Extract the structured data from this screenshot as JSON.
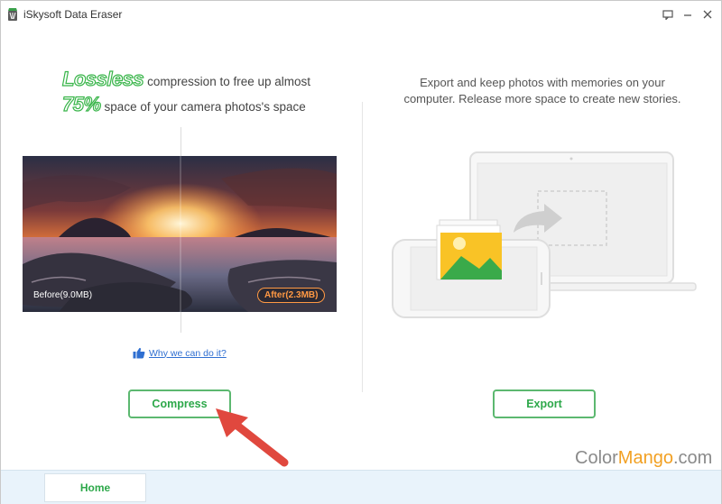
{
  "window": {
    "title": "iSkysoft Data Eraser"
  },
  "left_panel": {
    "headline_word_1": "Lossless",
    "headline_rest_1": "compression to free up almost",
    "headline_word_2": "75%",
    "headline_rest_2": "space of your camera photos's space",
    "before_label": "Before(9.0MB)",
    "after_label": "After(2.3MB)",
    "why_link": "Why we can do it?",
    "compress_button": "Compress"
  },
  "right_panel": {
    "description_line_1": "Export and keep photos with memories on your",
    "description_line_2": "computer. Release more space to create new stories.",
    "export_button": "Export"
  },
  "bottom_nav": {
    "home_tab": "Home"
  },
  "watermark": {
    "part1": "Color",
    "part2": "Mango",
    "part3": ".com"
  },
  "colors": {
    "accent_green": "#39b54a",
    "link_blue": "#2f6fd1",
    "after_orange": "#ff9944",
    "annotation_red": "#e0483e"
  },
  "icons": [
    "app-icon",
    "feedback-icon",
    "minimize-icon",
    "close-icon",
    "thumbs-up-icon",
    "export-arrow-icon",
    "photo-icon"
  ]
}
